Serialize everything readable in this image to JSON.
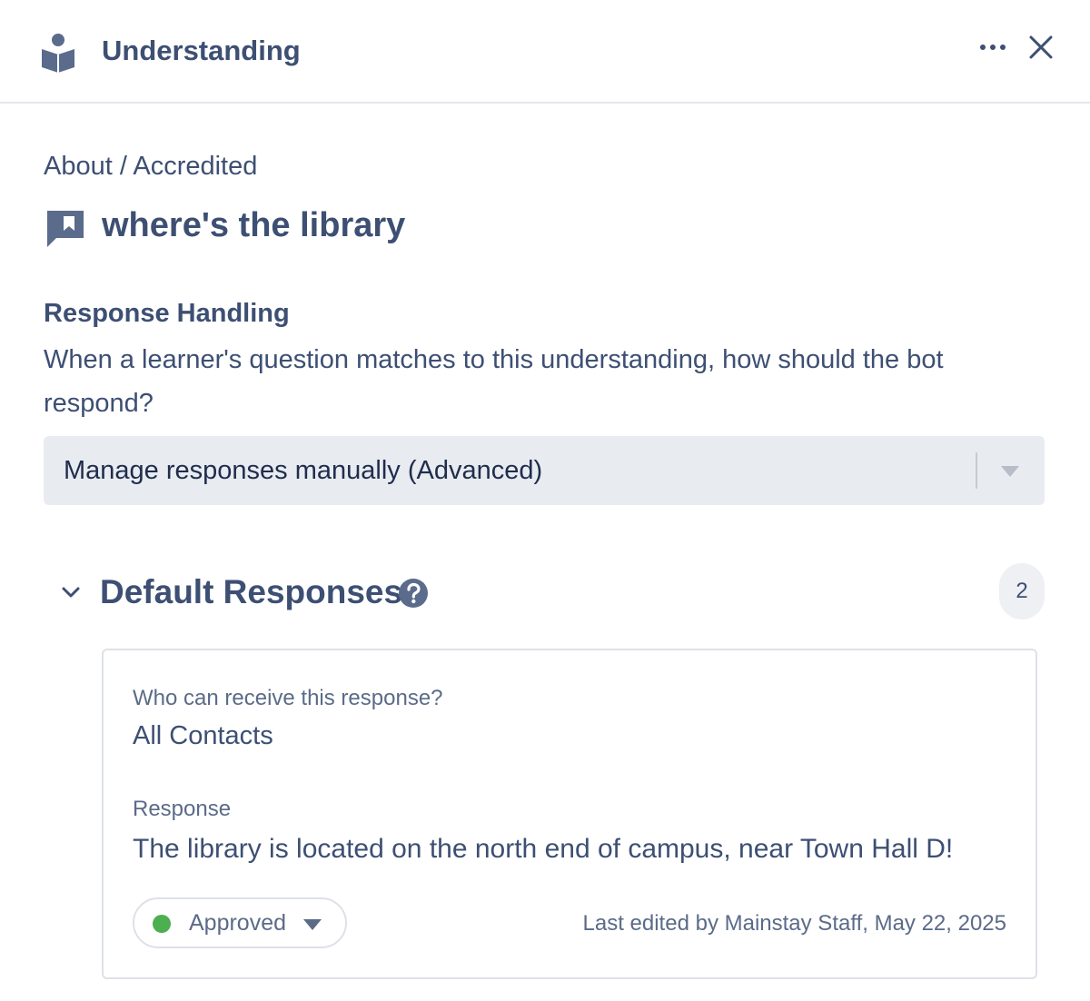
{
  "header": {
    "title": "Understanding",
    "logo_icon": "book-reader-icon",
    "more_icon": "more-horizontal-icon",
    "close_icon": "close-icon"
  },
  "breadcrumb": "About / Accredited",
  "question": {
    "icon": "chat-bookmark-icon",
    "title": "where's the library"
  },
  "response_handling": {
    "label": "Response Handling",
    "description": "When a learner's question matches to this understanding, how should the bot respond?",
    "selected_option": "Manage responses manually (Advanced)"
  },
  "default_responses": {
    "title": "Default Responses",
    "count": "2",
    "cards": [
      {
        "who_label": "Who can receive this response?",
        "who_value": "All Contacts",
        "response_label": "Response",
        "response_value": "The library is located on the north end of campus, near Town Hall D!",
        "status": "Approved",
        "status_color": "#4caf50",
        "last_edited": "Last edited by Mainstay Staff, May 22, 2025"
      }
    ]
  },
  "colors": {
    "text_primary": "#3d4f73",
    "select_bg": "#e8ebf0",
    "border": "#dde1e7"
  }
}
